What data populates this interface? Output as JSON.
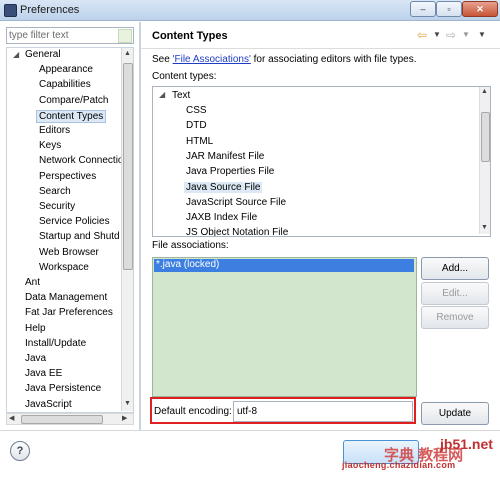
{
  "window": {
    "title": "Preferences",
    "close_label": "✕",
    "min_label": "–",
    "max_label": "▫"
  },
  "filter": {
    "placeholder": "type filter text"
  },
  "tree": {
    "items": [
      {
        "label": "General",
        "depth": 0,
        "expanded": true
      },
      {
        "label": "Appearance",
        "depth": 1
      },
      {
        "label": "Capabilities",
        "depth": 1
      },
      {
        "label": "Compare/Patch",
        "depth": 1
      },
      {
        "label": "Content Types",
        "depth": 1,
        "selected": true
      },
      {
        "label": "Editors",
        "depth": 1
      },
      {
        "label": "Keys",
        "depth": 1
      },
      {
        "label": "Network Connectio",
        "depth": 1
      },
      {
        "label": "Perspectives",
        "depth": 1
      },
      {
        "label": "Search",
        "depth": 1
      },
      {
        "label": "Security",
        "depth": 1
      },
      {
        "label": "Service Policies",
        "depth": 1
      },
      {
        "label": "Startup and Shutd",
        "depth": 1
      },
      {
        "label": "Web Browser",
        "depth": 1
      },
      {
        "label": "Workspace",
        "depth": 1
      },
      {
        "label": "Ant",
        "depth": 0
      },
      {
        "label": "Data Management",
        "depth": 0
      },
      {
        "label": "Fat Jar Preferences",
        "depth": 0
      },
      {
        "label": "Help",
        "depth": 0
      },
      {
        "label": "Install/Update",
        "depth": 0
      },
      {
        "label": "Java",
        "depth": 0
      },
      {
        "label": "Java EE",
        "depth": 0
      },
      {
        "label": "Java Persistence",
        "depth": 0
      },
      {
        "label": "JavaScript",
        "depth": 0
      }
    ]
  },
  "page": {
    "title": "Content Types",
    "description_prefix": "See ",
    "description_link": "'File Associations'",
    "description_suffix": " for associating editors with file types.",
    "content_types_label": "Content types:",
    "file_associations_label": "File associations:",
    "default_encoding_label": "Default encoding:",
    "default_encoding_value": "utf-8"
  },
  "content_types": {
    "root": "Text",
    "children": [
      {
        "label": "CSS"
      },
      {
        "label": "DTD"
      },
      {
        "label": "HTML"
      },
      {
        "label": "JAR Manifest File"
      },
      {
        "label": "Java Properties File"
      },
      {
        "label": "Java Source File",
        "selected": true
      },
      {
        "label": "JavaScript Source File"
      },
      {
        "label": "JAXB Index File"
      },
      {
        "label": "JS Object Notation File"
      }
    ]
  },
  "file_associations": {
    "items": [
      "*.java (locked)"
    ]
  },
  "buttons": {
    "add": "Add...",
    "edit": "Edit...",
    "remove": "Remove",
    "update": "Update",
    "help": "?"
  },
  "watermark": {
    "site": "jb51.net",
    "logo": "字典 教程网",
    "sub": "jiaocheng.chazidian.com"
  },
  "colors": {
    "selection": "#3d7fe0",
    "file_assoc_bg": "#d1e6cc",
    "highlight_border": "#e02020",
    "link": "#1c3ec7",
    "watermark": "#c03030"
  }
}
